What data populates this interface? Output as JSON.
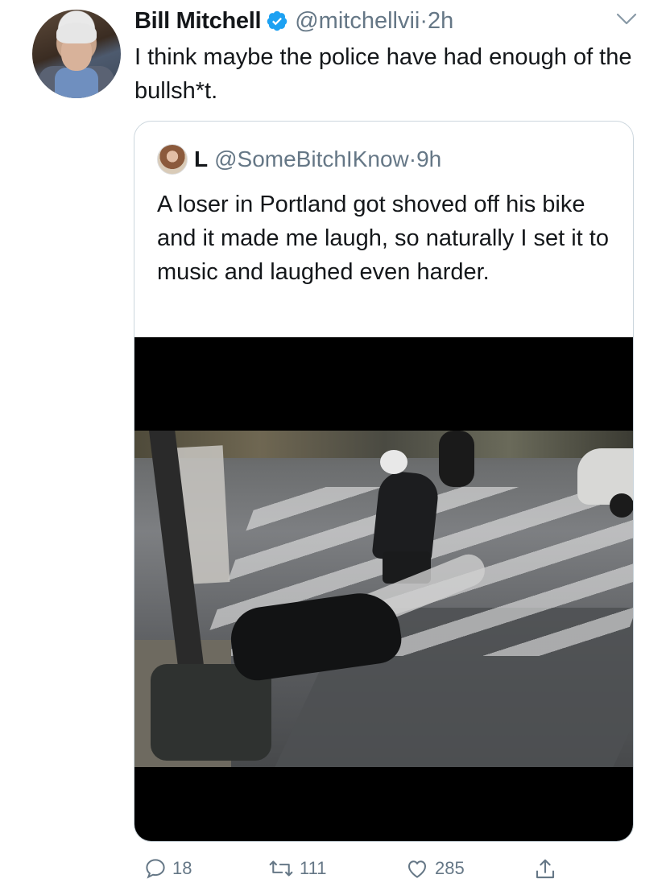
{
  "tweet": {
    "author_name": "Bill Mitchell",
    "handle": "@mitchellvii",
    "separator": "·",
    "time": "2h",
    "text": "I think maybe the police have had enough of the bullsh*t.",
    "icons": {
      "avatar": "profile-photo",
      "verified": "verified-badge-icon",
      "menu": "chevron-down-icon"
    }
  },
  "quoted_tweet": {
    "author_name": "L",
    "handle": "@SomeBitchIKnow",
    "separator": "·",
    "time": "9h",
    "text": "A loser in Portland got shoved off his bike and it made me laugh, so naturally I set it to music and laughed even harder.",
    "media": "video-thumbnail"
  },
  "actions": {
    "reply_count": "18",
    "retweet_count": "111",
    "like_count": "285",
    "icons": [
      "reply-icon",
      "retweet-icon",
      "like-icon",
      "share-icon"
    ]
  },
  "colors": {
    "text_primary": "#14171a",
    "text_secondary": "#657786",
    "verified_blue": "#1da1f2",
    "border": "#ccd6dd"
  }
}
